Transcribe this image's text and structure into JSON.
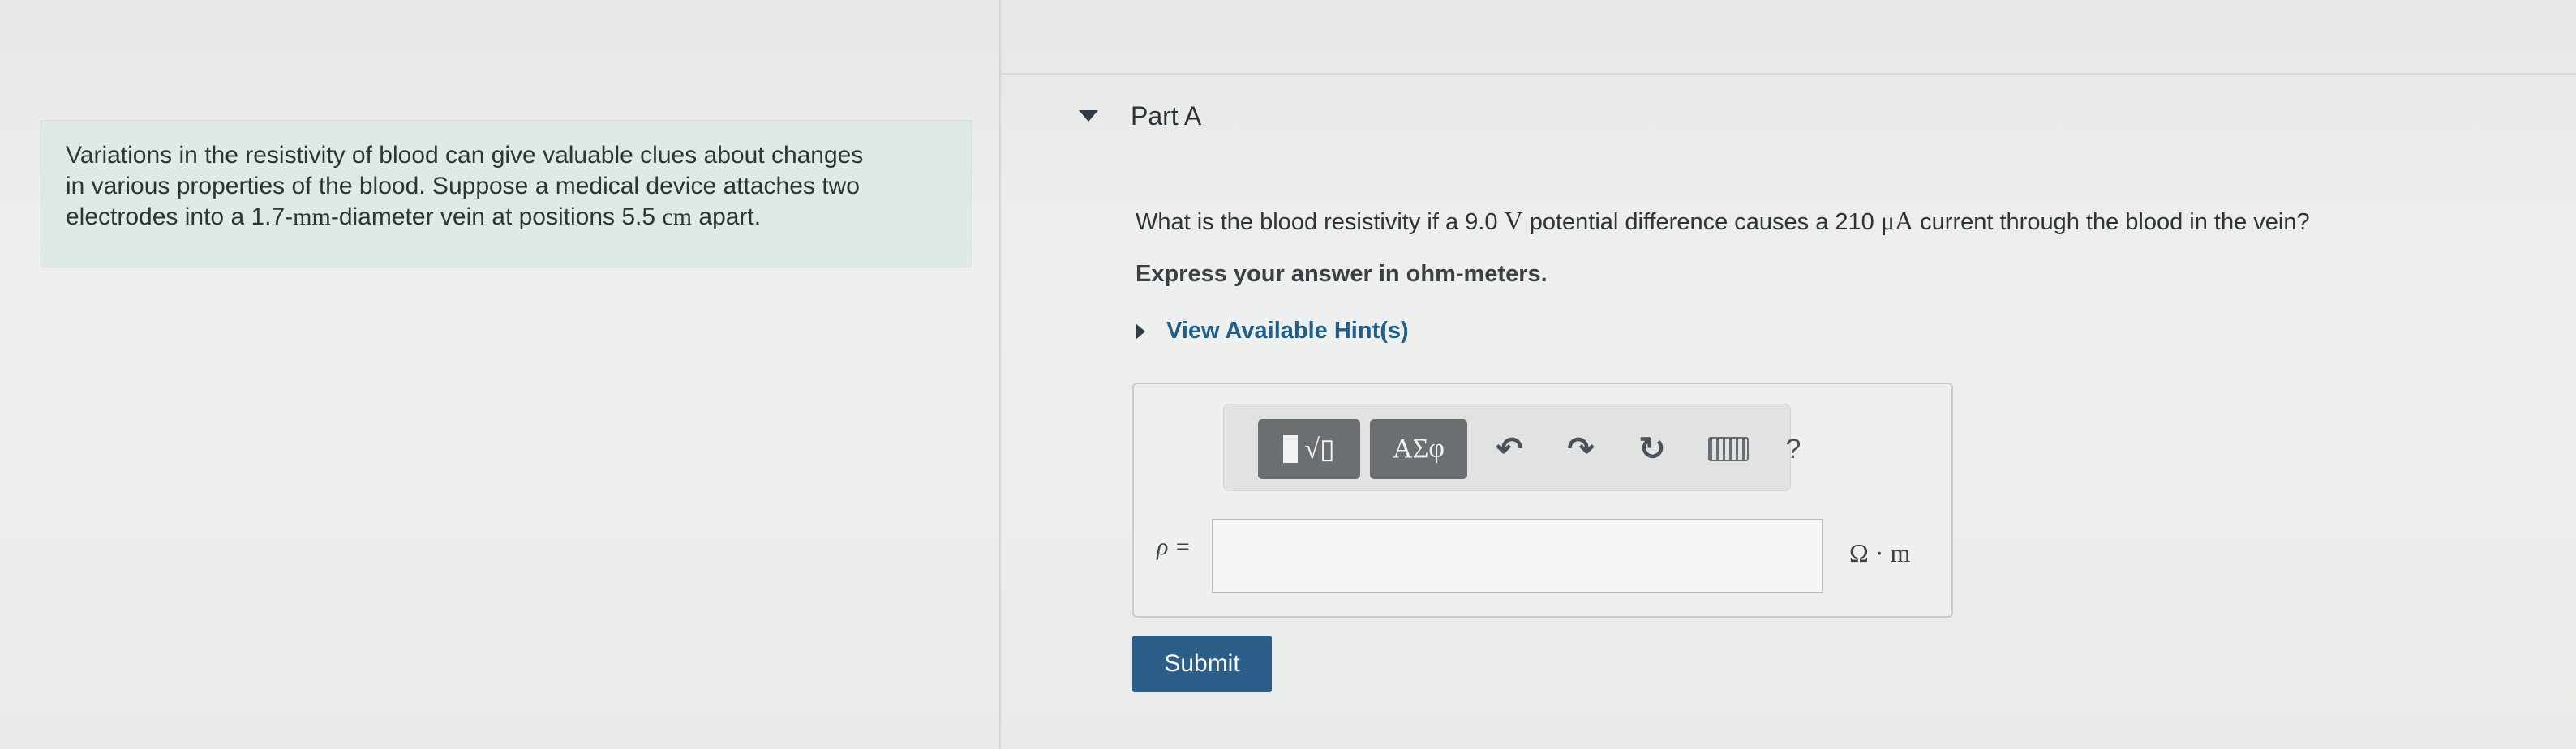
{
  "intro": {
    "line1": "Variations in the resistivity of blood can give valuable clues about changes",
    "line2": "in various properties of the blood. Suppose a medical device attaches two",
    "line3_a": "electrodes into a 1.7-",
    "line3_unit1": "mm",
    "line3_b": "-diameter vein at positions 5.5 ",
    "line3_unit2": "cm",
    "line3_c": " apart."
  },
  "part": {
    "title": "Part A"
  },
  "question": {
    "pre": "What is the blood resistivity if a 9.0 ",
    "unit_v": "V",
    "mid": " potential difference causes a 210 ",
    "unit_ua": "μA",
    "post": " current through the blood in the vein?"
  },
  "instruction": "Express your answer in ohm-meters.",
  "hint_link": "View Available Hint(s)",
  "toolbar": {
    "templates_label": "√▯",
    "greek_label": "ΑΣφ",
    "undo_icon": "undo-icon",
    "redo_icon": "redo-icon",
    "reset_icon": "reset-icon",
    "keyboard_icon": "keyboard-icon",
    "help_label": "?"
  },
  "answer": {
    "variable": "ρ =",
    "value": "",
    "units": "Ω · m"
  },
  "submit_label": "Submit",
  "colors": {
    "accent": "#2b5f8a",
    "hint_link": "#1f5f8a",
    "intro_bg": "#dfe9e6"
  }
}
